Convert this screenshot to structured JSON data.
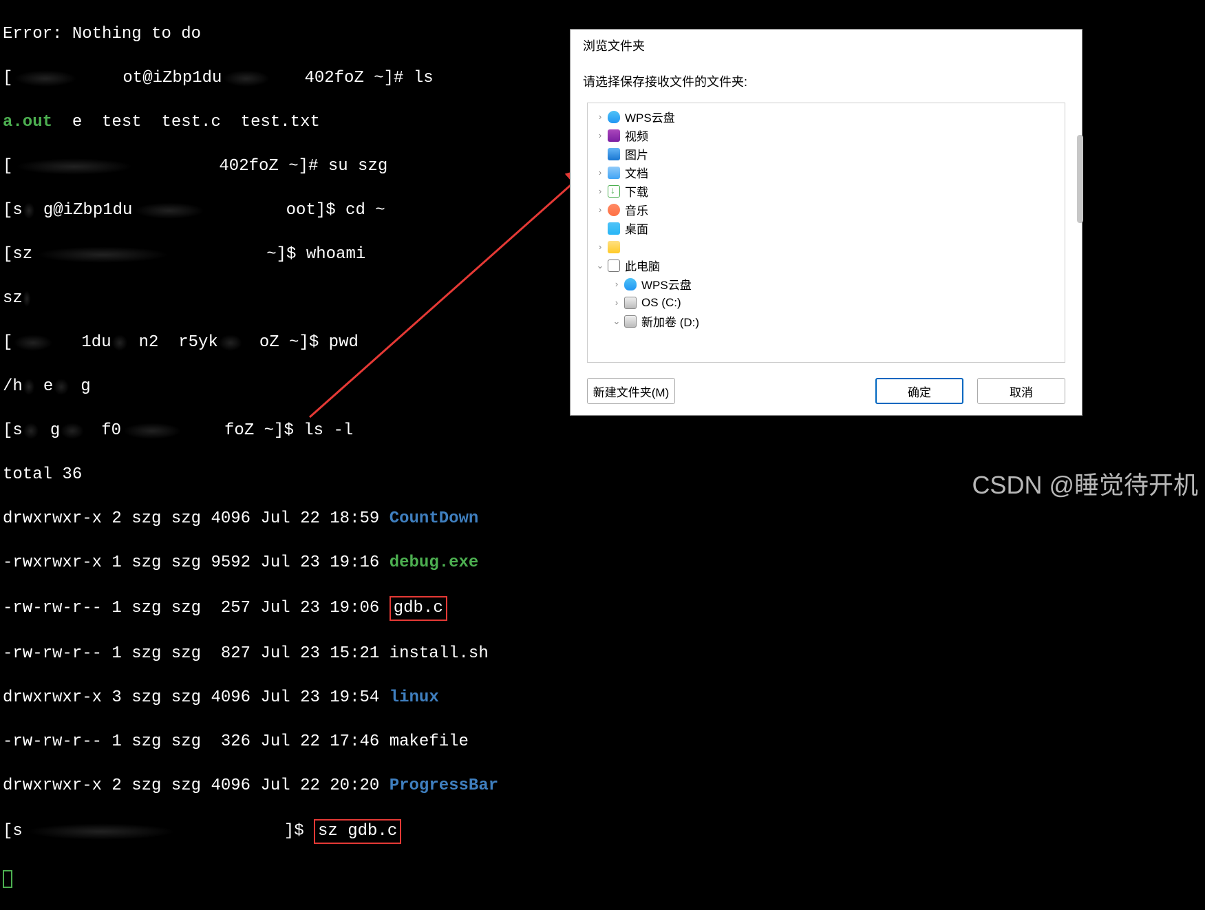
{
  "terminal": {
    "l1": "Error: Nothing to do",
    "l2a": "[",
    "l2b": "ot@iZbp1du",
    "l2c": "402foZ ~]# ls",
    "l3_aout": "a.out",
    "l3_rest": "  e  test  test.c  test.txt",
    "l4a": "[",
    "l4b": "402foZ ~]# su szg",
    "l5a": "[s",
    "l5b": "g@iZbp1du",
    "l5c": "   oot]$ cd ~",
    "l6a": "[sz",
    "l6b": "~]$ whoami",
    "l7": "sz",
    "l8a": "[",
    "l8b": "1du",
    "l8c": "n2  r5yk",
    "l8d": "oZ ~]$ pwd",
    "l9a": "/h",
    "l9b": "e",
    "l9c": "g",
    "l10a": "[s",
    "l10b": "g",
    "l10c": "f0",
    "l10d": "foZ ~]$ ls -l",
    "l11": "total 36",
    "r1a": "drwxrwxr-x 2 szg szg 4096 Jul 22 18:59 ",
    "r1b": "CountDown",
    "r2a": "-rwxrwxr-x 1 szg szg 9592 Jul 23 19:16 ",
    "r2b": "debug.exe",
    "r3a": "-rw-rw-r-- 1 szg szg  257 Jul 23 19:06 ",
    "r3b": "gdb.c",
    "r4": "-rw-rw-r-- 1 szg szg  827 Jul 23 15:21 install.sh",
    "r5a": "drwxrwxr-x 3 szg szg 4096 Jul 23 19:54 ",
    "r5b": "linux",
    "r6": "-rw-rw-r-- 1 szg szg  326 Jul 22 17:46 makefile",
    "r7a": "drwxrwxr-x 2 szg szg 4096 Jul 22 20:20 ",
    "r7b": "ProgressBar",
    "p1a": "[s",
    "p1b": "]$ ",
    "p1c": "sz gdb.c"
  },
  "dialog": {
    "title": "浏览文件夹",
    "instruction": "请选择保存接收文件的文件夹:",
    "tree": [
      {
        "level": 1,
        "expander": ">",
        "icon": "cloud",
        "label": "WPS云盘"
      },
      {
        "level": 1,
        "expander": ">",
        "icon": "video",
        "label": "视频"
      },
      {
        "level": 1,
        "expander": "",
        "icon": "image",
        "label": "图片"
      },
      {
        "level": 1,
        "expander": ">",
        "icon": "doc",
        "label": "文档"
      },
      {
        "level": 1,
        "expander": ">",
        "icon": "download",
        "label": "下载"
      },
      {
        "level": 1,
        "expander": ">",
        "icon": "music",
        "label": "音乐"
      },
      {
        "level": 1,
        "expander": "",
        "icon": "desktop",
        "label": "桌面"
      },
      {
        "level": 1,
        "expander": ">",
        "icon": "folder",
        "label": ""
      },
      {
        "level": 1,
        "expander": "v",
        "icon": "pc",
        "label": "此电脑"
      },
      {
        "level": 2,
        "expander": ">",
        "icon": "cloud",
        "label": "WPS云盘"
      },
      {
        "level": 2,
        "expander": ">",
        "icon": "disk",
        "label": "OS (C:)"
      },
      {
        "level": 2,
        "expander": "v",
        "icon": "disk",
        "label": "新加卷 (D:)"
      }
    ],
    "btn_new_folder": "新建文件夹(M)",
    "btn_ok": "确定",
    "btn_cancel": "取消"
  },
  "watermark": "CSDN @睡觉待开机"
}
